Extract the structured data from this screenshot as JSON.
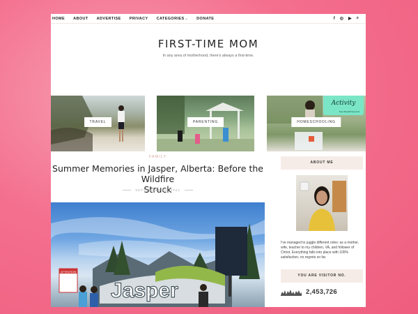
{
  "nav": {
    "links": [
      "HOME",
      "ABOUT",
      "ADVERTISE",
      "PRIVACY",
      "CATEGORIES",
      "DONATE"
    ],
    "categories_caret": "⌄",
    "icons": {
      "facebook": "f",
      "instagram": "◎",
      "youtube": "▶",
      "search": "⌕"
    }
  },
  "header": {
    "title": "FIRST-TIME MOM",
    "tagline": "In any area of motherhood, there's always a first-time."
  },
  "tiles": [
    {
      "label": "TRAVEL"
    },
    {
      "label": "PARENTING"
    },
    {
      "label": "HOMESCHOOLING",
      "card_title": "Activity",
      "card_small": "TeachingEdway.net"
    }
  ],
  "post": {
    "category": "FAMILY",
    "title_line1": "Summer Memories in Jasper, Alberta: Before the Wildfire",
    "title_line2": "Struck",
    "date": "SEPTEMBER 04, 2024",
    "image_sign_text": "Jasper",
    "image_attention_text": "ATTENTION"
  },
  "sidebar": {
    "about_heading": "ABOUT ME",
    "about_text": "I've managed to juggle different roles: as a mother, wife, teacher to my children, VA, and follower of Christ. Everything falls into place with 100% satisfaction, no regrets so far.",
    "visitor_heading": "YOU ARE VISITOR NO.",
    "visitor_count": "2,453,726"
  },
  "colors": {
    "background_pink": "#ef5d7e",
    "category_accent": "#d6a79e",
    "widget_bg": "#f6ece7"
  }
}
